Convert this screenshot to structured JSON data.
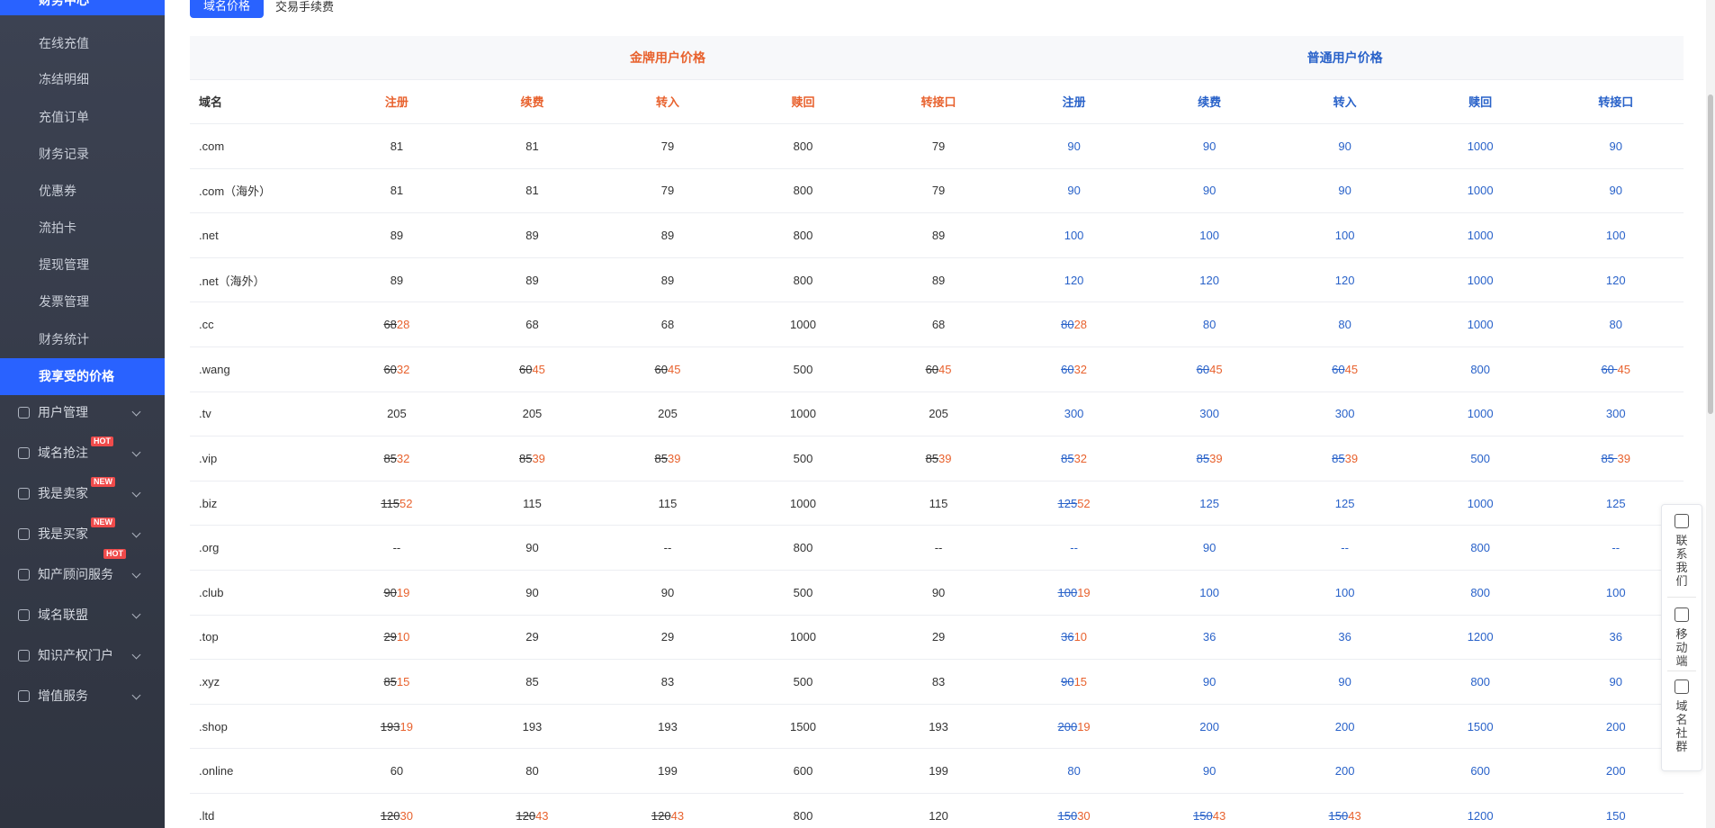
{
  "sidebar": {
    "active_top": "财务中心",
    "sub_items": [
      {
        "label": "在线充值"
      },
      {
        "label": "冻结明细"
      },
      {
        "label": "充值订单"
      },
      {
        "label": "财务记录"
      },
      {
        "label": "优惠券"
      },
      {
        "label": "流拍卡"
      },
      {
        "label": "提现管理"
      },
      {
        "label": "发票管理"
      },
      {
        "label": "财务统计"
      },
      {
        "label": "我享受的价格"
      }
    ],
    "menu_items": [
      {
        "label": "用户管理",
        "badge": ""
      },
      {
        "label": "域名抢注",
        "badge": "HOT"
      },
      {
        "label": "我是卖家",
        "badge": "NEW"
      },
      {
        "label": "我是买家",
        "badge": "NEW"
      },
      {
        "label": "知产顾问服务",
        "badge": "HOT"
      },
      {
        "label": "域名联盟",
        "badge": ""
      },
      {
        "label": "知识产权门户",
        "badge": ""
      },
      {
        "label": "增值服务",
        "badge": ""
      }
    ]
  },
  "tabs": {
    "active": "域名价格",
    "other": "交易手续费"
  },
  "table": {
    "group_gold": "金牌用户价格",
    "group_normal": "普通用户价格",
    "columns": [
      "域名",
      "注册",
      "续费",
      "转入",
      "赎回",
      "转接口",
      "注册",
      "续费",
      "转入",
      "赎回",
      "转接口"
    ],
    "rows": [
      {
        "name": ".com",
        "cells": [
          [
            "81",
            ""
          ],
          [
            "81",
            ""
          ],
          [
            "79",
            ""
          ],
          [
            "800",
            ""
          ],
          [
            "79",
            ""
          ],
          [
            "90",
            ""
          ],
          [
            "90",
            ""
          ],
          [
            "90",
            ""
          ],
          [
            "1000",
            ""
          ],
          [
            "90",
            ""
          ]
        ]
      },
      {
        "name": ".com（海外）",
        "cells": [
          [
            "81",
            ""
          ],
          [
            "81",
            ""
          ],
          [
            "79",
            ""
          ],
          [
            "800",
            ""
          ],
          [
            "79",
            ""
          ],
          [
            "90",
            ""
          ],
          [
            "90",
            ""
          ],
          [
            "90",
            ""
          ],
          [
            "1000",
            ""
          ],
          [
            "90",
            ""
          ]
        ]
      },
      {
        "name": ".net",
        "cells": [
          [
            "89",
            ""
          ],
          [
            "89",
            ""
          ],
          [
            "89",
            ""
          ],
          [
            "800",
            ""
          ],
          [
            "89",
            ""
          ],
          [
            "100",
            ""
          ],
          [
            "100",
            ""
          ],
          [
            "100",
            ""
          ],
          [
            "1000",
            ""
          ],
          [
            "100",
            ""
          ]
        ]
      },
      {
        "name": ".net（海外）",
        "cells": [
          [
            "89",
            ""
          ],
          [
            "89",
            ""
          ],
          [
            "89",
            ""
          ],
          [
            "800",
            ""
          ],
          [
            "89",
            ""
          ],
          [
            "120",
            ""
          ],
          [
            "120",
            ""
          ],
          [
            "120",
            ""
          ],
          [
            "1000",
            ""
          ],
          [
            "120",
            ""
          ]
        ]
      },
      {
        "name": ".cc",
        "cells": [
          [
            "68",
            "28"
          ],
          [
            "68",
            ""
          ],
          [
            "68",
            ""
          ],
          [
            "1000",
            ""
          ],
          [
            "68",
            ""
          ],
          [
            "80",
            "28"
          ],
          [
            "80",
            ""
          ],
          [
            "80",
            ""
          ],
          [
            "1000",
            ""
          ],
          [
            "80",
            ""
          ]
        ]
      },
      {
        "name": ".wang",
        "cells": [
          [
            "60",
            "32"
          ],
          [
            "60",
            "45"
          ],
          [
            "60",
            "45"
          ],
          [
            "500",
            ""
          ],
          [
            "60",
            "45"
          ],
          [
            "60",
            "32"
          ],
          [
            "60",
            "45"
          ],
          [
            "60",
            "45"
          ],
          [
            "800",
            ""
          ],
          [
            "60 ",
            "45"
          ]
        ]
      },
      {
        "name": ".tv",
        "cells": [
          [
            "205",
            ""
          ],
          [
            "205",
            ""
          ],
          [
            "205",
            ""
          ],
          [
            "1000",
            ""
          ],
          [
            "205",
            ""
          ],
          [
            "300",
            ""
          ],
          [
            "300",
            ""
          ],
          [
            "300",
            ""
          ],
          [
            "1000",
            ""
          ],
          [
            "300",
            ""
          ]
        ]
      },
      {
        "name": ".vip",
        "cells": [
          [
            "85",
            "32"
          ],
          [
            "85",
            "39"
          ],
          [
            "85",
            "39"
          ],
          [
            "500",
            ""
          ],
          [
            "85",
            "39"
          ],
          [
            "85",
            "32"
          ],
          [
            "85",
            "39"
          ],
          [
            "85",
            "39"
          ],
          [
            "500",
            ""
          ],
          [
            "85 ",
            "39"
          ]
        ]
      },
      {
        "name": ".biz",
        "cells": [
          [
            "115",
            "52"
          ],
          [
            "115",
            ""
          ],
          [
            "115",
            ""
          ],
          [
            "1000",
            ""
          ],
          [
            "115",
            ""
          ],
          [
            "125",
            "52"
          ],
          [
            "125",
            ""
          ],
          [
            "125",
            ""
          ],
          [
            "1000",
            ""
          ],
          [
            "125",
            ""
          ]
        ]
      },
      {
        "name": ".org",
        "cells": [
          [
            "--",
            ""
          ],
          [
            "90",
            ""
          ],
          [
            "--",
            ""
          ],
          [
            "800",
            ""
          ],
          [
            "--",
            ""
          ],
          [
            "--",
            ""
          ],
          [
            "90",
            ""
          ],
          [
            "--",
            ""
          ],
          [
            "800",
            ""
          ],
          [
            "--",
            ""
          ]
        ]
      },
      {
        "name": ".club",
        "cells": [
          [
            "90",
            "19"
          ],
          [
            "90",
            ""
          ],
          [
            "90",
            ""
          ],
          [
            "500",
            ""
          ],
          [
            "90",
            ""
          ],
          [
            "100",
            "19"
          ],
          [
            "100",
            ""
          ],
          [
            "100",
            ""
          ],
          [
            "800",
            ""
          ],
          [
            "100",
            ""
          ]
        ]
      },
      {
        "name": ".top",
        "cells": [
          [
            "29",
            "10"
          ],
          [
            "29",
            ""
          ],
          [
            "29",
            ""
          ],
          [
            "1000",
            ""
          ],
          [
            "29",
            ""
          ],
          [
            "36",
            "10"
          ],
          [
            "36",
            ""
          ],
          [
            "36",
            ""
          ],
          [
            "1200",
            ""
          ],
          [
            "36",
            ""
          ]
        ]
      },
      {
        "name": ".xyz",
        "cells": [
          [
            "85",
            "15"
          ],
          [
            "85",
            ""
          ],
          [
            "83",
            ""
          ],
          [
            "500",
            ""
          ],
          [
            "83",
            ""
          ],
          [
            "90",
            "15"
          ],
          [
            "90",
            ""
          ],
          [
            "90",
            ""
          ],
          [
            "800",
            ""
          ],
          [
            "90",
            ""
          ]
        ]
      },
      {
        "name": ".shop",
        "cells": [
          [
            "193",
            "19"
          ],
          [
            "193",
            ""
          ],
          [
            "193",
            ""
          ],
          [
            "1500",
            ""
          ],
          [
            "193",
            ""
          ],
          [
            "200",
            "19"
          ],
          [
            "200",
            ""
          ],
          [
            "200",
            ""
          ],
          [
            "1500",
            ""
          ],
          [
            "200",
            ""
          ]
        ]
      },
      {
        "name": ".online",
        "cells": [
          [
            "60",
            ""
          ],
          [
            "80",
            ""
          ],
          [
            "199",
            ""
          ],
          [
            "600",
            ""
          ],
          [
            "199",
            ""
          ],
          [
            "80",
            ""
          ],
          [
            "90",
            ""
          ],
          [
            "200",
            ""
          ],
          [
            "600",
            ""
          ],
          [
            "200",
            ""
          ]
        ]
      },
      {
        "name": ".ltd",
        "cells": [
          [
            "120",
            "30"
          ],
          [
            "120",
            "43"
          ],
          [
            "120",
            "43"
          ],
          [
            "800",
            ""
          ],
          [
            "120",
            ""
          ],
          [
            "150",
            "30"
          ],
          [
            "150",
            "43"
          ],
          [
            "150",
            "43"
          ],
          [
            "1200",
            ""
          ],
          [
            "150",
            ""
          ]
        ]
      }
    ]
  },
  "float_panel": [
    {
      "label": "联系我们",
      "icon": "chat-icon"
    },
    {
      "label": "移动端",
      "icon": "mobile-icon"
    },
    {
      "label": "域名社群",
      "icon": "com-icon"
    }
  ],
  "colors": {
    "accent": "#2962ff",
    "gold": "#e8622e",
    "normal_blue": "#2962c9",
    "sidebar_bg": "#3a3f4c"
  }
}
